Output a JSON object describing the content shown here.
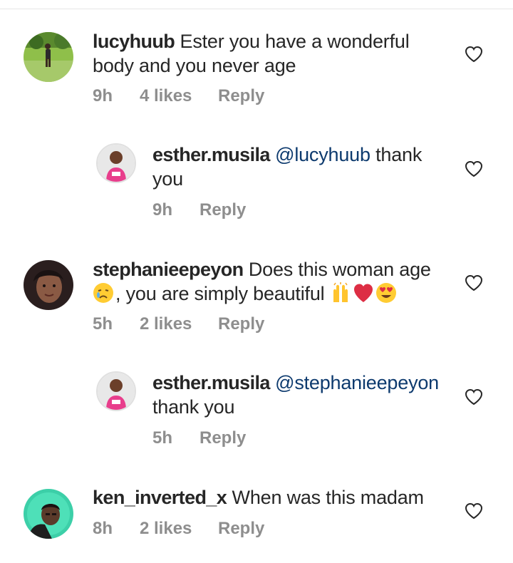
{
  "comments": [
    {
      "username": "lucyhuub",
      "text": "Ester you have a wonderful body and you never age",
      "time": "9h",
      "likes": "4 likes",
      "reply": "Reply"
    },
    {
      "username": "esther.musila",
      "mention": "@lucyhuub",
      "text": "thank you",
      "time": "9h",
      "reply": "Reply"
    },
    {
      "username": "stephanieepeyon",
      "text_part1": "Does this woman age",
      "text_part2": ", you are simply beautiful",
      "emojis": [
        "crying-face",
        "raising-hands",
        "red-heart",
        "heart-eyes"
      ],
      "time": "5h",
      "likes": "2 likes",
      "reply": "Reply"
    },
    {
      "username": "esther.musila",
      "mention": "@stephanieepeyon",
      "text": "thank you",
      "time": "5h",
      "reply": "Reply"
    },
    {
      "username": "ken_inverted_x",
      "text": "When was this madam",
      "time": "8h",
      "likes": "2 likes",
      "reply": "Reply"
    }
  ],
  "colors": {
    "username": "#262626",
    "mention": "#0d3a6e",
    "meta": "#8e8e8e",
    "divider": "#e6e6e6"
  }
}
